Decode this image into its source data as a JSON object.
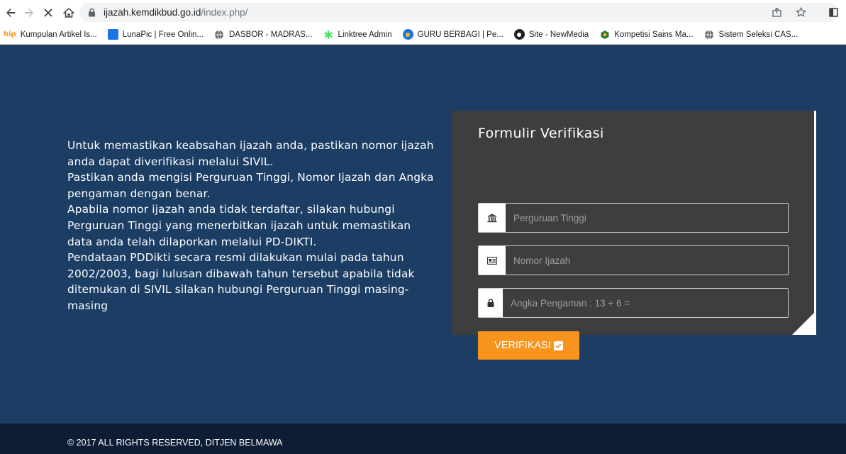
{
  "browser": {
    "url_domain": "ijazah.kemdikbud.go.id",
    "url_path": "/index.php/"
  },
  "bookmarks": [
    {
      "label": "Kumpulan Artikel Is...",
      "icon": "hip-icon",
      "icon_text": "hip",
      "color": "#f7941d"
    },
    {
      "label": "LunaPic | Free Onlin...",
      "icon": "lunapic-icon",
      "color": "#1a73e8"
    },
    {
      "label": "DASBOR - MADRAS...",
      "icon": "globe-icon",
      "color": "#5f6368"
    },
    {
      "label": "Linktree Admin",
      "icon": "linktree-icon",
      "color": "#43e660"
    },
    {
      "label": "GURU BERBAGI | Pe...",
      "icon": "guru-berbagi-icon",
      "color": "#1a73e8"
    },
    {
      "label": "Site - NewMedia",
      "icon": "newmedia-icon",
      "color": "#202124"
    },
    {
      "label": "Kompetisi Sains Ma...",
      "icon": "kemenag-icon",
      "color": "#2e7d32"
    },
    {
      "label": "Sistem Seleksi CAS...",
      "icon": "globe-icon",
      "color": "#5f6368"
    }
  ],
  "info": {
    "paragraphs": [
      "Untuk memastikan keabsahan ijazah anda, pastikan nomor ijazah anda dapat diverifikasi melalui SIVIL.",
      "Pastikan anda mengisi Perguruan Tinggi, Nomor Ijazah dan Angka pengaman dengan benar.",
      "Apabila nomor ijazah anda tidak terdaftar, silakan hubungi Perguruan Tinggi yang menerbitkan ijazah untuk memastikan data anda telah dilaporkan melalui PD-DIKTI.",
      "Pendataan PDDikti secara resmi dilakukan mulai pada tahun 2002/2003, bagi lulusan dibawah tahun tersebut apabila tidak ditemukan di SIVIL silakan hubungi Perguruan Tinggi masing-masing"
    ]
  },
  "form": {
    "title": "Formulir Verifikasi",
    "perguruan_placeholder": "Perguruan Tinggi",
    "nomor_placeholder": "Nomor Ijazah",
    "pengaman_placeholder": "Angka Pengaman : 13 + 6 =",
    "submit_label": "VERIFIKASI"
  },
  "footer": {
    "text": "© 2017 ALL RIGHTS RESERVED, DITJEN BELMAWA"
  },
  "colors": {
    "page_bg": "#1c3d64",
    "card_bg": "#3d3e3f",
    "accent": "#f7941d",
    "footer_bg": "#0e1d36"
  }
}
